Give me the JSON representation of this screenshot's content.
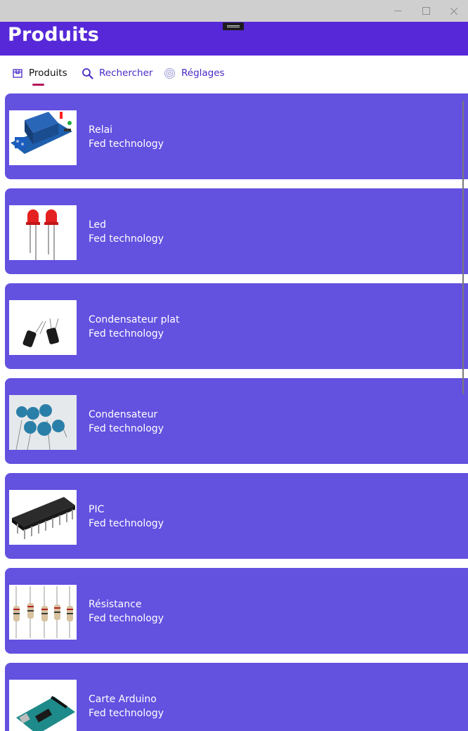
{
  "window": {
    "minimize_glyph": "—",
    "maximize_glyph": "□",
    "close_glyph": "✕"
  },
  "header": {
    "title": "Produits"
  },
  "tabs": [
    {
      "label": "Produits",
      "icon": "box-icon",
      "active": true
    },
    {
      "label": "Rechercher",
      "icon": "search-icon",
      "active": false
    },
    {
      "label": "Réglages",
      "icon": "settings-icon",
      "active": false
    }
  ],
  "products": [
    {
      "name": "Relai",
      "vendor": "Fed technology",
      "image": "relay-module-image"
    },
    {
      "name": "Led",
      "vendor": "Fed technology",
      "image": "red-led-image"
    },
    {
      "name": "Condensateur plat",
      "vendor": "Fed technology",
      "image": "electrolytic-capacitor-image"
    },
    {
      "name": "Condensateur",
      "vendor": "Fed technology",
      "image": "ceramic-capacitor-image"
    },
    {
      "name": "PIC",
      "vendor": "Fed technology",
      "image": "pic-chip-image"
    },
    {
      "name": "Résistance",
      "vendor": "Fed technology",
      "image": "resistor-image"
    },
    {
      "name": "Carte Arduino",
      "vendor": "Fed technology",
      "image": "arduino-board-image"
    }
  ],
  "colors": {
    "header": "#5628d8",
    "card": "#6351e0",
    "tab_accent": "#4a2ac7",
    "active_underline": "#b4185a"
  }
}
